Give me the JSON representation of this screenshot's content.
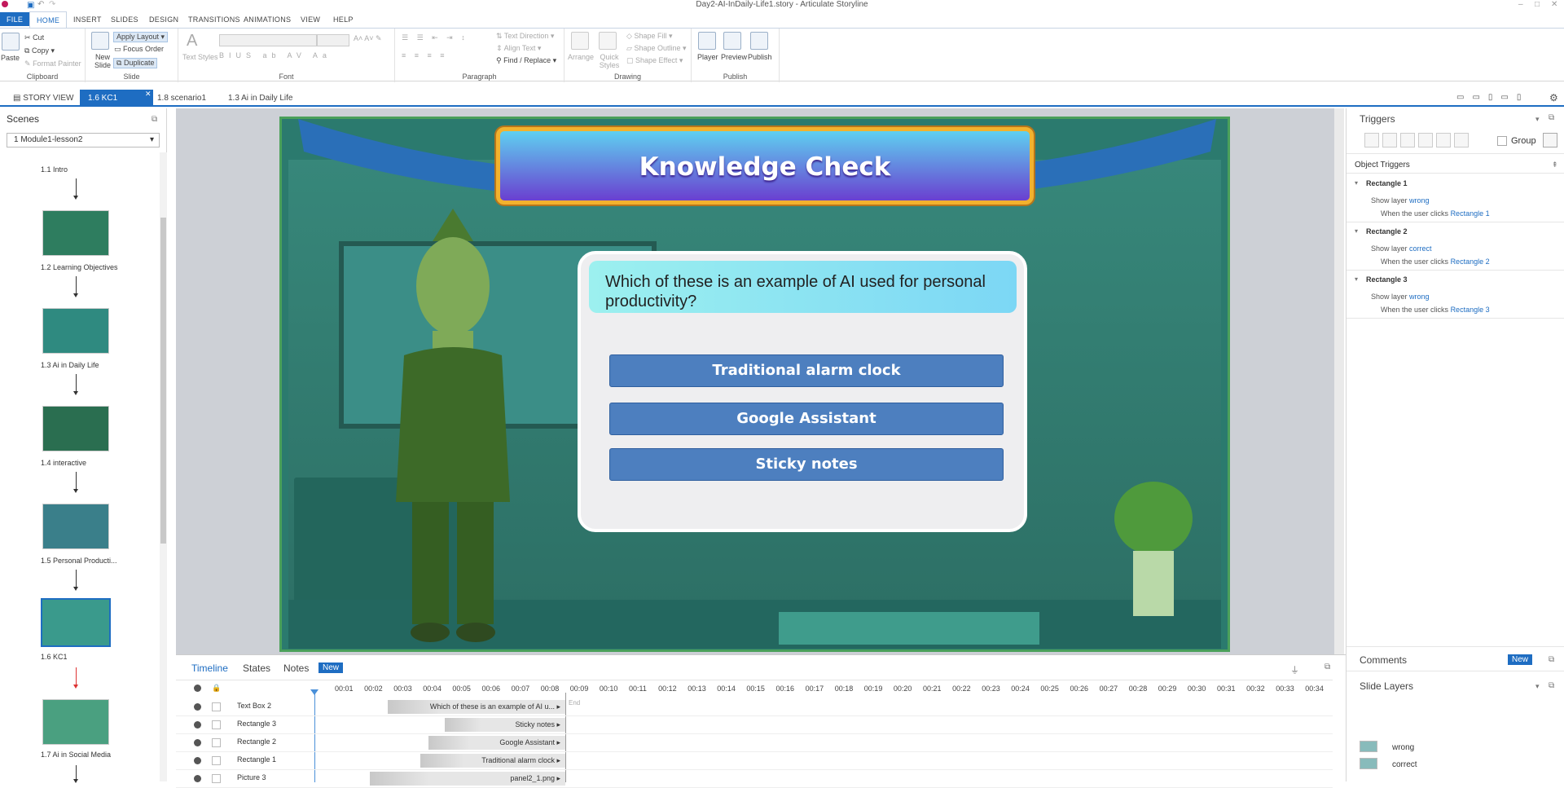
{
  "window": {
    "title": "Day2-AI-InDaily-Life1.story - Articulate Storyline"
  },
  "ribbon_tabs": [
    "FILE",
    "HOME",
    "INSERT",
    "SLIDES",
    "DESIGN",
    "TRANSITIONS",
    "ANIMATIONS",
    "VIEW",
    "HELP"
  ],
  "ribbon": {
    "clipboard": {
      "label": "Clipboard",
      "paste": "Paste",
      "cut": "Cut",
      "copy": "Copy",
      "format_painter": "Format Painter"
    },
    "slide": {
      "label": "Slide",
      "new_slide": "New Slide",
      "apply_layout": "Apply Layout",
      "focus_order": "Focus Order",
      "duplicate": "Duplicate"
    },
    "font": {
      "label": "Font",
      "text_styles": "Text Styles"
    },
    "paragraph": {
      "label": "Paragraph",
      "text_direction": "Text Direction",
      "align_text": "Align Text",
      "find_replace": "Find / Replace"
    },
    "drawing": {
      "label": "Drawing",
      "arrange": "Arrange",
      "quick_styles": "Quick Styles",
      "shape_fill": "Shape Fill",
      "shape_outline": "Shape Outline",
      "shape_effect": "Shape Effect"
    },
    "publish": {
      "label": "Publish",
      "player": "Player",
      "preview": "Preview",
      "publish": "Publish"
    }
  },
  "doc_tabs": [
    "STORY VIEW",
    "1.6 KC1",
    "1.8 scenario1",
    "1.3 Ai in Daily Life"
  ],
  "scenes": {
    "title": "Scenes",
    "dropdown": "1 Module1-lesson2",
    "slides": [
      "1.1 Intro",
      "1.2 Learning Objectives",
      "1.3 Ai in Daily Life",
      "1.4 interactive",
      "1.5 Personal Producti...",
      "1.6 KC1",
      "1.7 Ai in Social Media"
    ]
  },
  "slide": {
    "title": "Knowledge Check",
    "question": "Which of these is an example of AI used for personal productivity?",
    "answers": [
      "Traditional alarm clock",
      "Google Assistant",
      "Sticky notes"
    ]
  },
  "triggers": {
    "title": "Triggers",
    "group": "Group",
    "object_triggers": "Object Triggers",
    "items": [
      {
        "object": "Rectangle 1",
        "action": "Show layer",
        "layer": "wrong",
        "when": "When the user",
        "clicks": "clicks",
        "target": "Rectangle 1"
      },
      {
        "object": "Rectangle 2",
        "action": "Show layer",
        "layer": "correct",
        "when": "When the user",
        "clicks": "clicks",
        "target": "Rectangle 2"
      },
      {
        "object": "Rectangle 3",
        "action": "Show layer",
        "layer": "wrong",
        "when": "When the user",
        "clicks": "clicks",
        "target": "Rectangle 3"
      }
    ]
  },
  "timeline": {
    "tabs": [
      "Timeline",
      "States",
      "Notes"
    ],
    "new_badge": "New",
    "end_label": "End",
    "ticks": [
      "00:01",
      "00:02",
      "00:03",
      "00:04",
      "00:05",
      "00:06",
      "00:07",
      "00:08",
      "00:09",
      "00:10",
      "00:11",
      "00:12",
      "00:13",
      "00:14",
      "00:15",
      "00:16",
      "00:17",
      "00:18",
      "00:19",
      "00:20",
      "00:21",
      "00:22",
      "00:23",
      "00:24",
      "00:25",
      "00:26",
      "00:27",
      "00:28",
      "00:29",
      "00:30",
      "00:31",
      "00:32",
      "00:33",
      "00:34"
    ],
    "rows": [
      {
        "name": "Text Box 2",
        "bar": "Which of these is an example of AI u..."
      },
      {
        "name": "Rectangle 3",
        "bar": "Sticky notes"
      },
      {
        "name": "Rectangle 2",
        "bar": "Google Assistant"
      },
      {
        "name": "Rectangle 1",
        "bar": "Traditional alarm clock"
      },
      {
        "name": "Picture 3",
        "bar": "panel2_1.png"
      }
    ]
  },
  "comments": {
    "title": "Comments",
    "badge": "New"
  },
  "slide_layers": {
    "title": "Slide Layers",
    "layers": [
      "wrong",
      "correct"
    ]
  }
}
